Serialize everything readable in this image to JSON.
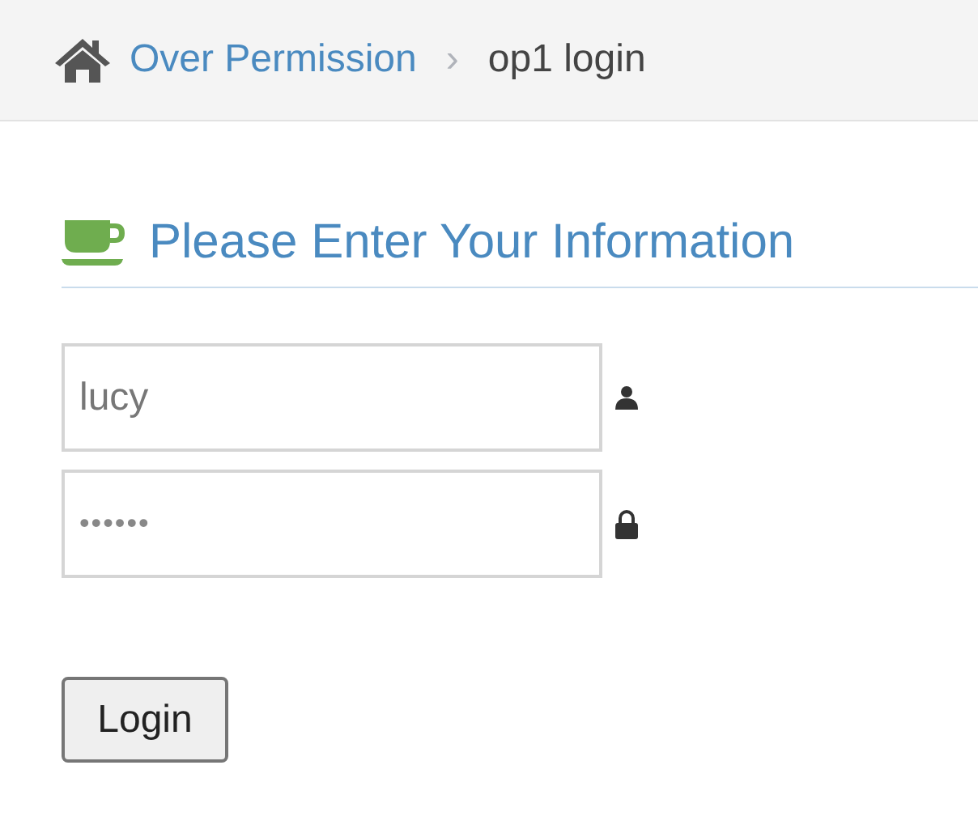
{
  "breadcrumb": {
    "parent": "Over Permission",
    "separator": "›",
    "current": "op1 login"
  },
  "heading": "Please Enter Your Information",
  "fields": [
    {
      "kind": "text",
      "value": "lucy"
    },
    {
      "kind": "password",
      "value": "••••••"
    }
  ],
  "button": "Login"
}
